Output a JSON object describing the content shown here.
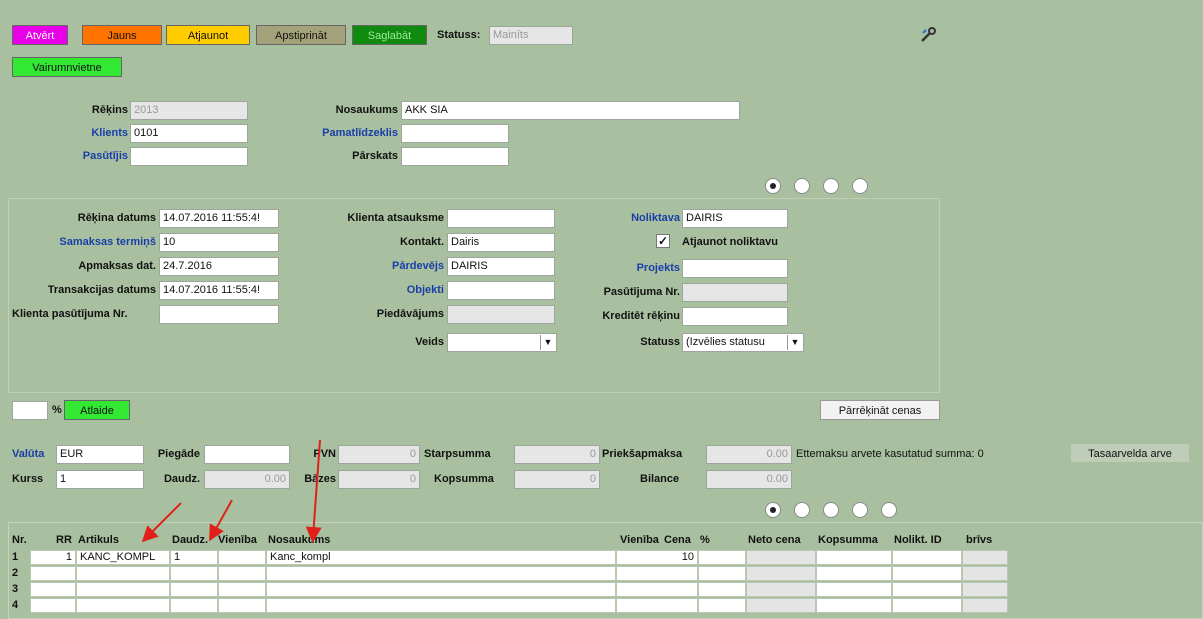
{
  "toolbar": {
    "buttons": [
      {
        "label": "Atvērt",
        "color": "#e800e8"
      },
      {
        "label": "Jauns",
        "color": "#ff7300"
      },
      {
        "label": "Atjaunot",
        "color": "#ffcc00"
      },
      {
        "label": "Apstiprināt",
        "color": "#a3a27a"
      },
      {
        "label": "Saglabāt",
        "color": "#0f8a0f"
      }
    ],
    "status_label": "Statuss:",
    "status_value": "Mainīts",
    "warehouse_button": "Vairumnvietne"
  },
  "header": {
    "invoice_label": "Rēķins",
    "invoice_value": "2013",
    "client_label": "Klients",
    "client_value": "0101",
    "orderer_label": "Pasūtījis",
    "orderer_value": "",
    "name_label": "Nosaukums",
    "name_value": "AKK SIA",
    "basis_label": "Pamatlīdzeklis",
    "basis_value": "",
    "report_label": "Pārskats",
    "report_value": ""
  },
  "details": {
    "invoice_date_label": "Rēķina datums",
    "invoice_date_value": "14.07.2016 11:55:4!",
    "payment_term_label": "Samaksas termiņš",
    "payment_term_value": "10",
    "payment_date_label": "Apmaksas dat.",
    "payment_date_value": "24.7.2016",
    "transaction_date_label": "Transakcijas datums",
    "transaction_date_value": "14.07.2016 11:55:4!",
    "client_order_label": "Klienta pasūtījuma Nr.",
    "client_order_value": "",
    "client_ref_label": "Klienta atsauksme",
    "client_ref_value": "",
    "contact_label": "Kontakt.",
    "contact_value": "Dairis",
    "seller_label": "Pārdevējs",
    "seller_value": "DAIRIS",
    "objects_label": "Objekti",
    "objects_value": "",
    "offer_label": "Piedāvājums",
    "offer_value": "",
    "type_label": "Veids",
    "type_value": "",
    "warehouse_label": "Noliktava",
    "warehouse_value": "DAIRIS",
    "update_stock_label": "Atjaunot noliktavu",
    "project_label": "Projekts",
    "project_value": "",
    "order_no_label": "Pasūtījuma Nr.",
    "order_no_value": "",
    "credit_label": "Kreditēt rēķinu",
    "credit_value": "",
    "status_label": "Statuss",
    "status_value": "(Izvēlies statusu"
  },
  "discount": {
    "percent_value": "",
    "percent_symbol": "%",
    "button": "Atlaide",
    "recalc_button": "Pārrēķināt cenas"
  },
  "totals": {
    "currency_label": "Valūta",
    "currency_value": "EUR",
    "delivery_label": "Piegāde",
    "delivery_value": "",
    "vat_label": "PVN",
    "vat_value": "0",
    "subtotal_label": "Starpsumma",
    "subtotal_value": "0",
    "prepay_label": "Priekšapmaksa",
    "prepay_value": "0.00",
    "prepay_note": "Ettemaksu arvete kasutatud summa: 0",
    "rate_label": "Kurss",
    "rate_value": "1",
    "qty_label": "Daudz.",
    "qty_value": "0.00",
    "base_label": "Bāzes",
    "base_value": "0",
    "total_label": "Kopsumma",
    "total_value": "0",
    "balance_label": "Bilance",
    "balance_value": "0.00",
    "offset_button": "Tasaarvelda arve"
  },
  "table": {
    "headers": [
      "Nr.",
      "RR",
      "Artikuls",
      "Daudz.",
      "Vienība",
      "Nosaukums",
      "Vienība",
      "Cena",
      "%",
      "Neto cena",
      "Kopsumma",
      "Nolikt. ID",
      "brīvs"
    ],
    "rows": [
      {
        "nr": "1",
        "rr": "1",
        "article": "KANC_KOMPL",
        "qty": "1",
        "unit": "",
        "name": "Kanc_kompl",
        "price": "10"
      },
      {
        "nr": "2",
        "rr": "",
        "article": "",
        "qty": "",
        "unit": "",
        "name": "",
        "price": ""
      },
      {
        "nr": "3",
        "rr": "",
        "article": "",
        "qty": "",
        "unit": "",
        "name": "",
        "price": ""
      },
      {
        "nr": "4",
        "rr": "",
        "article": "",
        "qty": "",
        "unit": "",
        "name": "",
        "price": ""
      }
    ]
  }
}
